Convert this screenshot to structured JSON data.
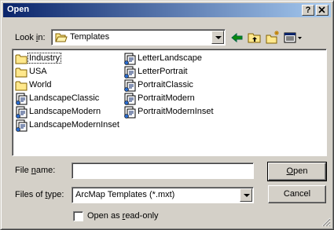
{
  "window": {
    "title": "Open",
    "help_label": "?",
    "close_label": "X"
  },
  "look_in": {
    "label_pre": "Look ",
    "label_key": "i",
    "label_post": "n:",
    "value": "Templates"
  },
  "toolbar": {
    "icons": [
      "back-arrow-icon",
      "up-folder-icon",
      "new-folder-icon",
      "view-menu-icon"
    ]
  },
  "files": [
    {
      "name": "Industry",
      "type": "folder",
      "focused": true
    },
    {
      "name": "USA",
      "type": "folder"
    },
    {
      "name": "World",
      "type": "folder"
    },
    {
      "name": "LandscapeClassic",
      "type": "template"
    },
    {
      "name": "LandscapeModern",
      "type": "template"
    },
    {
      "name": "LandscapeModernInset",
      "type": "template"
    },
    {
      "name": "LetterLandscape",
      "type": "template"
    },
    {
      "name": "LetterPortrait",
      "type": "template"
    },
    {
      "name": "PortraitClassic",
      "type": "template"
    },
    {
      "name": "PortraitModern",
      "type": "template"
    },
    {
      "name": "PortraitModernInset",
      "type": "template"
    }
  ],
  "file_name": {
    "label_pre": "File ",
    "label_key": "n",
    "label_post": "ame:",
    "value": ""
  },
  "file_type": {
    "label_pre": "Files of ",
    "label_key": "t",
    "label_post": "ype:",
    "value": "ArcMap Templates (*.mxt)"
  },
  "buttons": {
    "open_key": "O",
    "open_rest": "pen",
    "cancel": "Cancel"
  },
  "read_only": {
    "label_pre": "Open as ",
    "label_key": "r",
    "label_post": "ead-only",
    "checked": false
  }
}
